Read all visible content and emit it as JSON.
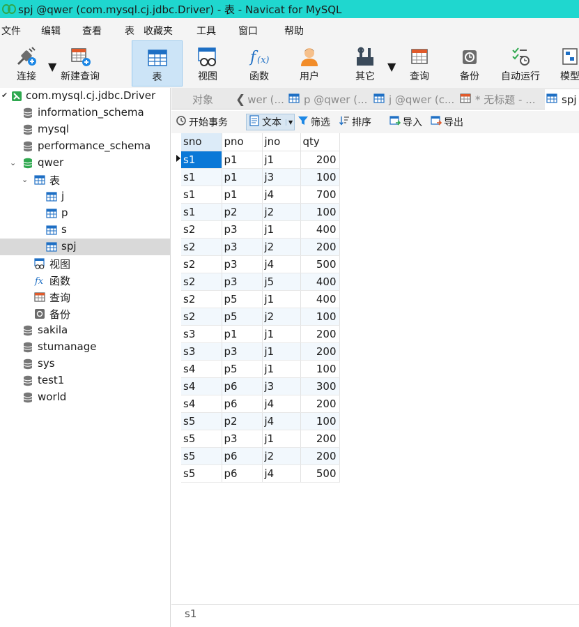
{
  "window": {
    "title": "spj @qwer (com.mysql.cj.jdbc.Driver) - 表 - Navicat for MySQL"
  },
  "menu": [
    "文件",
    "编辑",
    "查看",
    "表",
    "收藏夹",
    "工具",
    "窗口",
    "帮助"
  ],
  "toolbar": {
    "connect": "连接",
    "new_query": "新建查询",
    "table": "表",
    "view": "视图",
    "function": "函数",
    "user": "用户",
    "other": "其它",
    "query": "查询",
    "backup": "备份",
    "autorun": "自动运行",
    "model": "模型"
  },
  "tree": {
    "connection": "com.mysql.cj.jdbc.Driver",
    "databases_top": [
      "information_schema",
      "mysql",
      "performance_schema"
    ],
    "open_db": "qwer",
    "tables_group": "表",
    "tables": [
      "j",
      "p",
      "s",
      "spj"
    ],
    "views_group": "视图",
    "functions_group": "函数",
    "queries_group": "查询",
    "backups_group": "备份",
    "databases_bottom": [
      "sakila",
      "stumanage",
      "sys",
      "test1",
      "world"
    ]
  },
  "tabs": {
    "objects": "对象",
    "t1": "wer (...",
    "t2": "p @qwer (...",
    "t3": "j @qwer (c...",
    "t4": "* 无标题 - ...",
    "t5": "spj"
  },
  "actions": {
    "begin_tx": "开始事务",
    "text": "文本",
    "filter": "筛选",
    "sort": "排序",
    "import": "导入",
    "export": "导出"
  },
  "grid": {
    "columns": [
      "sno",
      "pno",
      "jno",
      "qty"
    ],
    "rows": [
      [
        "s1",
        "p1",
        "j1",
        "200"
      ],
      [
        "s1",
        "p1",
        "j3",
        "100"
      ],
      [
        "s1",
        "p1",
        "j4",
        "700"
      ],
      [
        "s1",
        "p2",
        "j2",
        "100"
      ],
      [
        "s2",
        "p3",
        "j1",
        "400"
      ],
      [
        "s2",
        "p3",
        "j2",
        "200"
      ],
      [
        "s2",
        "p3",
        "j4",
        "500"
      ],
      [
        "s2",
        "p3",
        "j5",
        "400"
      ],
      [
        "s2",
        "p5",
        "j1",
        "400"
      ],
      [
        "s2",
        "p5",
        "j2",
        "100"
      ],
      [
        "s3",
        "p1",
        "j1",
        "200"
      ],
      [
        "s3",
        "p3",
        "j1",
        "200"
      ],
      [
        "s4",
        "p5",
        "j1",
        "100"
      ],
      [
        "s4",
        "p6",
        "j3",
        "300"
      ],
      [
        "s4",
        "p6",
        "j4",
        "200"
      ],
      [
        "s5",
        "p2",
        "j4",
        "100"
      ],
      [
        "s5",
        "p3",
        "j1",
        "200"
      ],
      [
        "s5",
        "p6",
        "j2",
        "200"
      ],
      [
        "s5",
        "p6",
        "j4",
        "500"
      ]
    ]
  },
  "status": {
    "cell_value": "s1"
  },
  "colors": {
    "titlebar": "#1fd7cf",
    "selection": "#0a78d7",
    "active_tool": "#cce4f7"
  }
}
